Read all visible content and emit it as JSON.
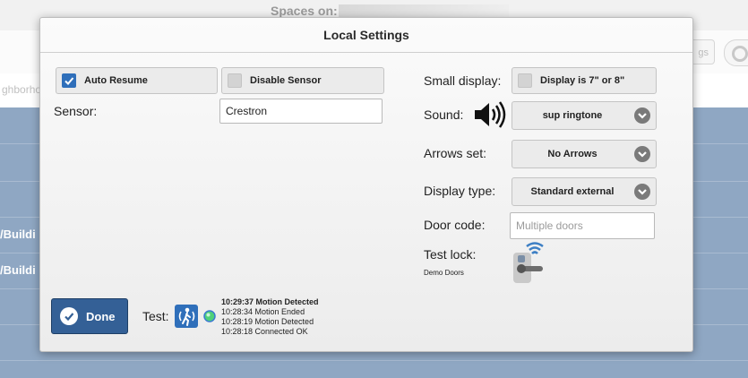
{
  "background": {
    "title": "Spaces on:",
    "settings_fragment": "gs",
    "neighborhood_fragment": "ghborho",
    "building_rows": [
      "/Buildi",
      "/Buildi"
    ]
  },
  "modal": {
    "title": "Local Settings",
    "auto_resume": {
      "label": "Auto Resume",
      "checked": true
    },
    "disable_sensor": {
      "label": "Disable Sensor",
      "checked": false
    },
    "sensor": {
      "label": "Sensor:",
      "value": "Crestron"
    },
    "small_display": {
      "label": "Small display:",
      "option_label": "Display is 7\" or 8\"",
      "checked": false
    },
    "sound": {
      "label": "Sound:",
      "value": "sup ringtone",
      "icon": "speaker-icon"
    },
    "arrows_set": {
      "label": "Arrows set:",
      "value": "No Arrows"
    },
    "display_type": {
      "label": "Display type:",
      "value": "Standard external"
    },
    "door_code": {
      "label": "Door code:",
      "value": "",
      "placeholder": "Multiple doors"
    },
    "test_lock": {
      "label": "Test lock:",
      "sub_label": "Demo Doors",
      "icon": "smart-lock-icon"
    },
    "done_label": "Done",
    "test_label": "Test:",
    "motion_log": [
      "10:29:37 Motion Detected",
      "10:28:34 Motion Ended",
      "10:28:19 Motion Detected",
      "10:28:18 Connected OK"
    ],
    "colors": {
      "accent": "#2f6fba",
      "done_button": "#346096",
      "status_led": "#4fd17a"
    }
  }
}
